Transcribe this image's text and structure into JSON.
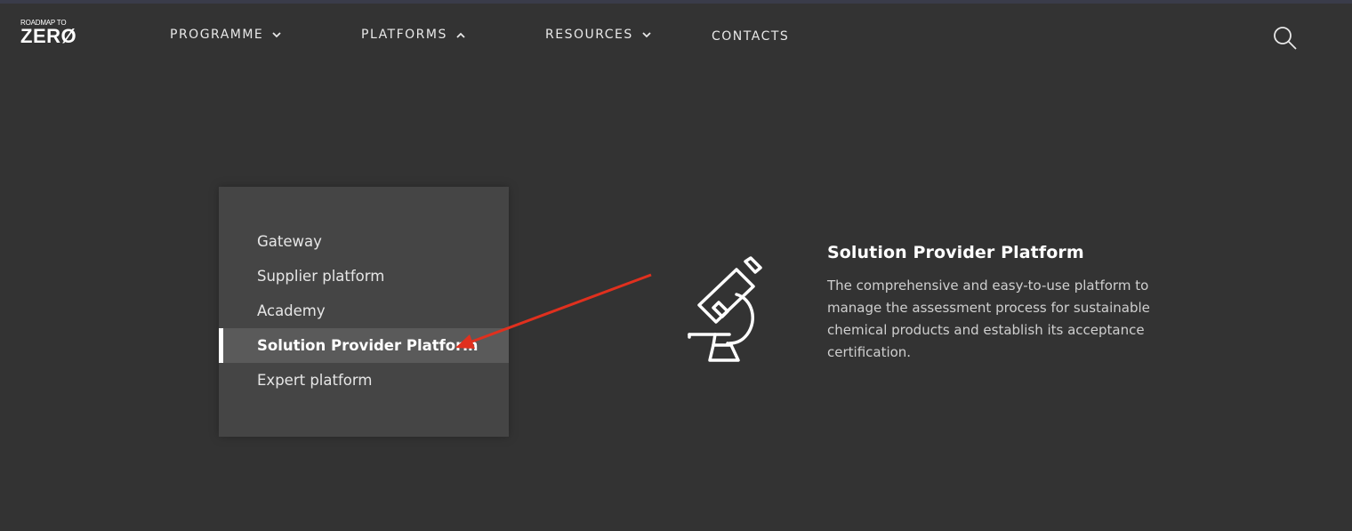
{
  "brand": {
    "logo_top": "ROADMAP TO",
    "logo_main": "ZERØ"
  },
  "nav": {
    "items": [
      {
        "label": "PROGRAMME",
        "chevron": "chevron-down-icon"
      },
      {
        "label": "PLATFORMS",
        "chevron": "chevron-up-icon"
      },
      {
        "label": "RESOURCES",
        "chevron": "chevron-down-icon"
      },
      {
        "label": "CONTACTS"
      }
    ],
    "search_icon": "search-icon"
  },
  "dropdown": {
    "items": [
      {
        "label": "Gateway"
      },
      {
        "label": "Supplier platform"
      },
      {
        "label": "Academy"
      },
      {
        "label": "Solution Provider Platform",
        "active": true
      },
      {
        "label": "Expert platform"
      }
    ]
  },
  "info": {
    "icon": "microscope-icon",
    "title": "Solution Provider Platform",
    "description": "The comprehensive and easy-to-use platform to manage the assessment process for sustainable chemical products and establish its acceptance certification."
  },
  "colors": {
    "background": "#333333",
    "dropdown_bg": "#454545",
    "active_item_bg": "#5a5a5a",
    "annotation_arrow": "#e0301e"
  }
}
